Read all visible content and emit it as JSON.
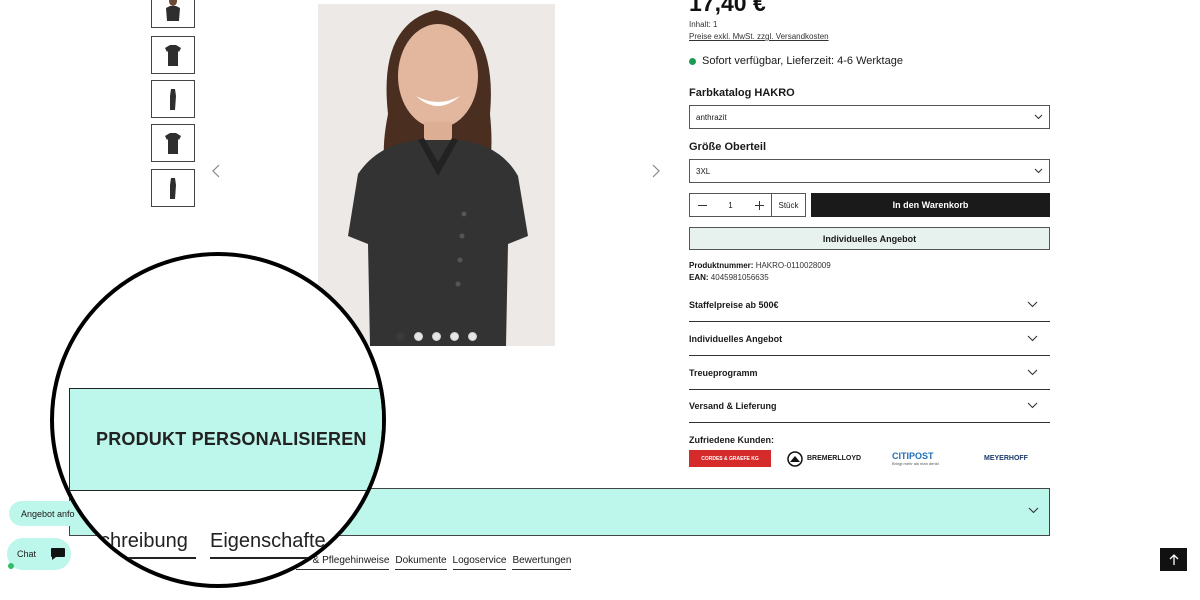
{
  "product": {
    "price": "17,40 €",
    "price_suffix": "*",
    "content": "Inhalt: 1",
    "price_note": "Preise exkl. MwSt. zzgl. Versandkosten",
    "stock": "Sofort verfügbar, Lieferzeit: 4-6 Werktage",
    "stock_color": "#1f9a54"
  },
  "options": {
    "color_label": "Farbkatalog HAKRO",
    "color_value": "anthrazit",
    "size_label": "Größe Oberteil",
    "size_value": "3XL"
  },
  "cart": {
    "quantity": "1",
    "unit": "Stück",
    "add_to_cart": "In den Warenkorb",
    "individual_offer": "Individuelles Angebot"
  },
  "meta": {
    "product_number_label": "Produktnummer:",
    "product_number": "HAKRO-0110028009",
    "ean_label": "EAN:",
    "ean": "4045981056635"
  },
  "accordion": [
    {
      "label": "Staffelpreise ab 500€"
    },
    {
      "label": "Individuelles Angebot"
    },
    {
      "label": "Treueprogramm"
    },
    {
      "label": "Versand & Lieferung"
    }
  ],
  "customers": {
    "title": "Zufriedene Kunden:",
    "logos": [
      {
        "text": "CORDES & GRAEFE KG"
      },
      {
        "text": "BREMERLLOYD"
      },
      {
        "text": "CITIPOST",
        "sub": "Bringt mehr als man denkt"
      },
      {
        "text": "MEYERHOFF"
      }
    ]
  },
  "personalize": {
    "label": "PRODUKT PERSONALISIEREN",
    "color": "#bdf6ea"
  },
  "tabs": {
    "magnified": [
      "Beschreibung",
      "Eigenschaften"
    ],
    "visible_small": [
      "Wasch- & Pflegehinweise",
      "Dokumente",
      "Logoservice",
      "Bewertungen"
    ],
    "small_partial": "ch- & Pflegehinweise"
  },
  "magnified_tabs": {
    "tab1_partial": "chreibung",
    "tab2_partial": "Eigenschafte"
  },
  "gallery": {
    "thumb_count": 5,
    "dot_count": 5,
    "active_dot": 0
  },
  "floating": {
    "offer_button": "Angebot anfo",
    "chat_button": "Chat"
  },
  "icons": {
    "thumb_icon": "shirt-icon",
    "prev": "chevron-left-icon",
    "next": "chevron-right-icon",
    "select": "chevron-down-icon",
    "chat": "chat-bubble-icon",
    "to_top": "arrow-up-icon"
  }
}
